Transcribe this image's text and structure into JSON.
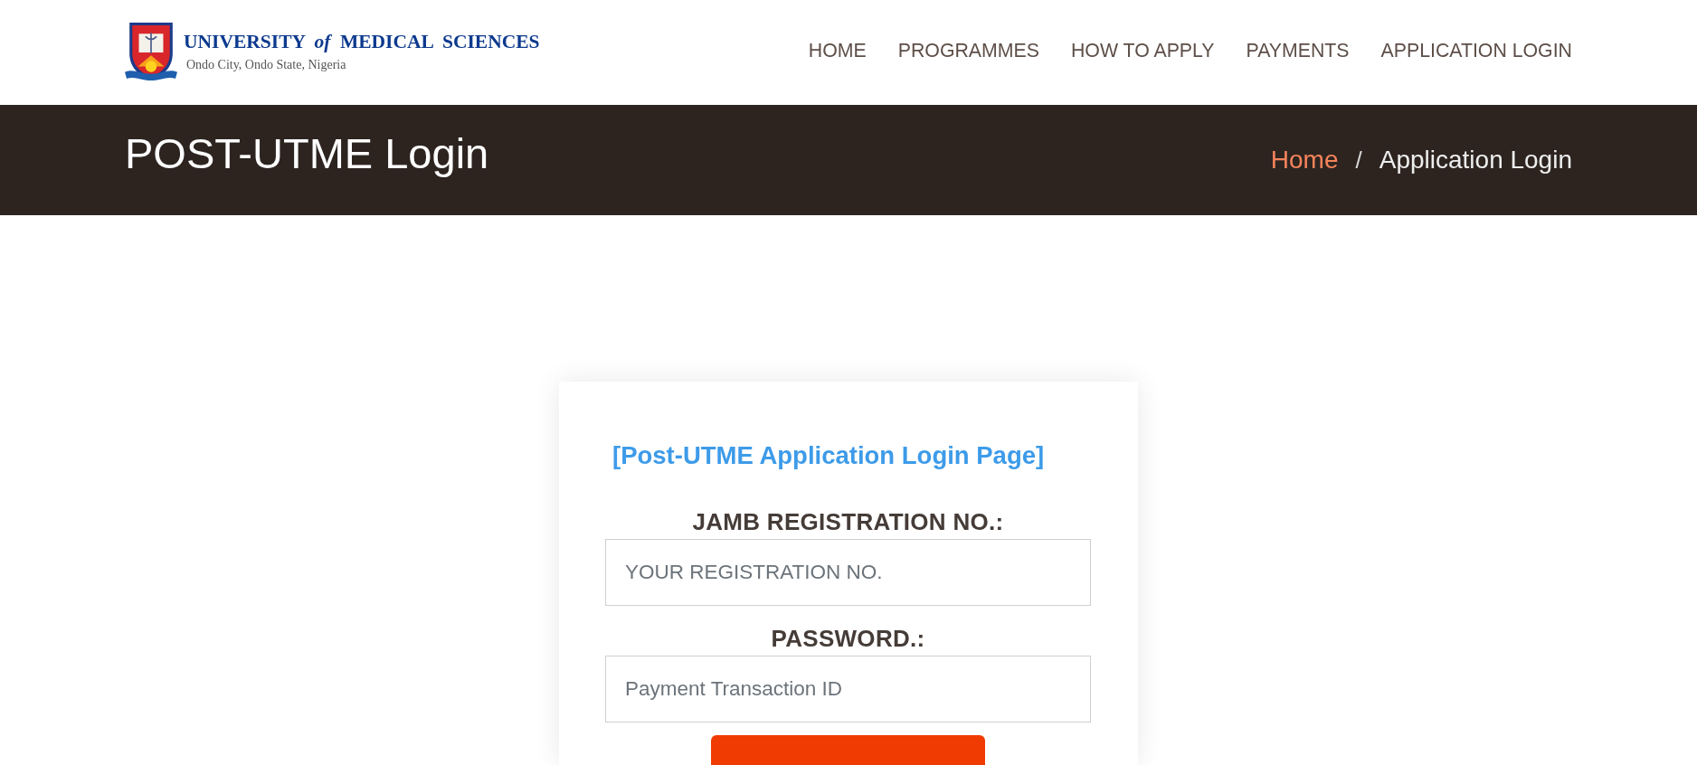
{
  "header": {
    "logo": {
      "title": "UNIVERSITY *of* MEDICAL SCIENCES",
      "subtitle": "Ondo City, Ondo State, Nigeria"
    },
    "nav": [
      {
        "label": "HOME"
      },
      {
        "label": "PROGRAMMES"
      },
      {
        "label": "HOW TO APPLY"
      },
      {
        "label": "PAYMENTS"
      },
      {
        "label": "APPLICATION LOGIN"
      }
    ]
  },
  "banner": {
    "title": "POST-UTME Login",
    "separator": "/",
    "breadcrumb": [
      {
        "label": "Home",
        "kind": "link"
      },
      {
        "label": "Application Login",
        "kind": "current"
      }
    ]
  },
  "login_card": {
    "heading": "[Post-UTME Application Login Page]",
    "fields": [
      {
        "label": "JAMB REGISTRATION NO.:",
        "placeholder": "YOUR REGISTRATION NO."
      },
      {
        "label": "PASSWORD.:",
        "placeholder": "Payment Transaction ID"
      }
    ]
  }
}
